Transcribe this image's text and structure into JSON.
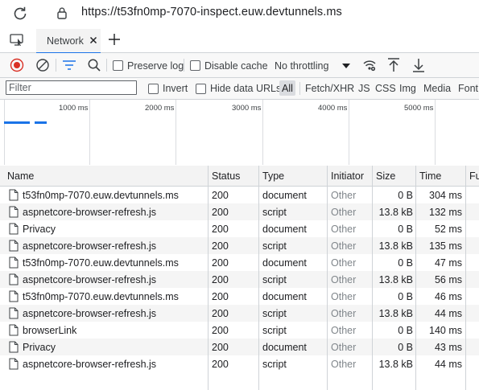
{
  "browser": {
    "url": "https://t53fn0mp-7070-inspect.euw.devtunnels.ms"
  },
  "tabs": {
    "active_label": "Network"
  },
  "toolbar": {
    "preserve_log": "Preserve log",
    "disable_cache": "Disable cache",
    "throttling": "No throttling"
  },
  "filter": {
    "placeholder": "Filter",
    "invert": "Invert",
    "hide_data_urls": "Hide data URLs",
    "types": [
      "All",
      "Fetch/XHR",
      "JS",
      "CSS",
      "Img",
      "Media",
      "Font"
    ]
  },
  "overview": {
    "ticks": [
      "1000 ms",
      "2000 ms",
      "3000 ms",
      "4000 ms",
      "5000 ms"
    ]
  },
  "table": {
    "columns": {
      "name": "Name",
      "status": "Status",
      "type": "Type",
      "initiator": "Initiator",
      "size": "Size",
      "time": "Time",
      "fulfilled": "Fu"
    },
    "rows": [
      {
        "name": "t53fn0mp-7070.euw.devtunnels.ms",
        "status": "200",
        "type": "document",
        "initiator": "Other",
        "size": "0 B",
        "time": "304 ms"
      },
      {
        "name": "aspnetcore-browser-refresh.js",
        "status": "200",
        "type": "script",
        "initiator": "Other",
        "size": "13.8 kB",
        "time": "132 ms"
      },
      {
        "name": "Privacy",
        "status": "200",
        "type": "document",
        "initiator": "Other",
        "size": "0 B",
        "time": "52 ms"
      },
      {
        "name": "aspnetcore-browser-refresh.js",
        "status": "200",
        "type": "script",
        "initiator": "Other",
        "size": "13.8 kB",
        "time": "135 ms"
      },
      {
        "name": "t53fn0mp-7070.euw.devtunnels.ms",
        "status": "200",
        "type": "document",
        "initiator": "Other",
        "size": "0 B",
        "time": "47 ms"
      },
      {
        "name": "aspnetcore-browser-refresh.js",
        "status": "200",
        "type": "script",
        "initiator": "Other",
        "size": "13.8 kB",
        "time": "56 ms"
      },
      {
        "name": "t53fn0mp-7070.euw.devtunnels.ms",
        "status": "200",
        "type": "document",
        "initiator": "Other",
        "size": "0 B",
        "time": "46 ms"
      },
      {
        "name": "aspnetcore-browser-refresh.js",
        "status": "200",
        "type": "script",
        "initiator": "Other",
        "size": "13.8 kB",
        "time": "44 ms"
      },
      {
        "name": "browserLink",
        "status": "200",
        "type": "script",
        "initiator": "Other",
        "size": "0 B",
        "time": "140 ms"
      },
      {
        "name": "Privacy",
        "status": "200",
        "type": "document",
        "initiator": "Other",
        "size": "0 B",
        "time": "43 ms"
      },
      {
        "name": "aspnetcore-browser-refresh.js",
        "status": "200",
        "type": "script",
        "initiator": "Other",
        "size": "13.8 kB",
        "time": "44 ms"
      }
    ]
  },
  "icons": {
    "reload": "reload-icon",
    "lock": "lock-icon",
    "device_toolbar": "device-toolbar-icon",
    "close": "close-icon",
    "add_tab": "plus-icon",
    "record": "record-icon",
    "clear": "clear-icon",
    "filter": "filter-icon",
    "search": "search-icon",
    "network_conditions": "network-conditions-icon",
    "import": "upload-icon",
    "export": "download-icon",
    "file": "file-icon"
  },
  "colors": {
    "accent": "#1a73e8",
    "record": "#d93025"
  }
}
